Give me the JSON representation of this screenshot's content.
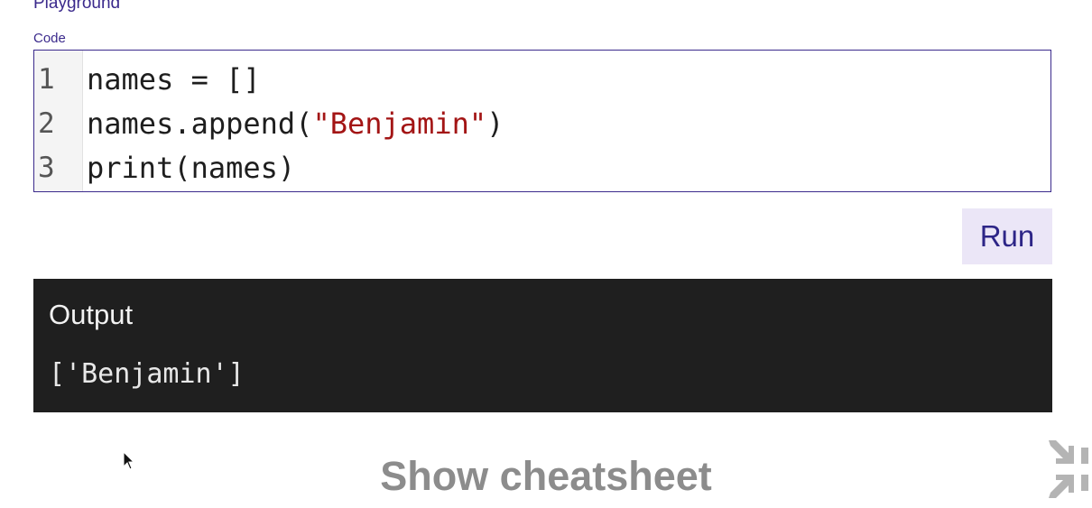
{
  "header": {
    "title": "Playground"
  },
  "editor": {
    "label": "Code",
    "lines": [
      {
        "number": "1",
        "code": "names = []"
      },
      {
        "number": "2",
        "code_prefix": "names.append(",
        "code_string": "\"Benjamin\"",
        "code_suffix": ")"
      },
      {
        "number": "3",
        "code": "print(names)"
      }
    ]
  },
  "actions": {
    "run_label": "Run"
  },
  "output": {
    "heading": "Output",
    "text": "['Benjamin']"
  },
  "footer": {
    "cheatsheet_label": "Show cheatsheet",
    "collapse_icon": "collapse-arrows-icon"
  },
  "colors": {
    "accent": "#3b2a8c",
    "run_button_bg": "#ebe6f7",
    "output_bg": "#1f1f1f",
    "string_literal": "#a31515"
  }
}
